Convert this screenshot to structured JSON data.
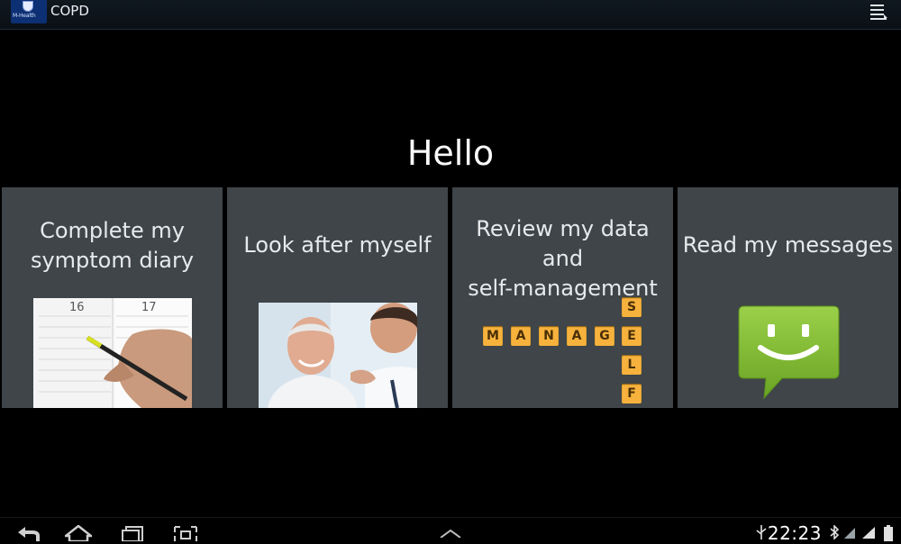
{
  "action_bar": {
    "title": "COPD",
    "logo_text": "M-Health",
    "menu_icon": "overflow-menu-icon"
  },
  "greeting": "Hello",
  "tiles": [
    {
      "label_line1": "Complete my",
      "label_line2": "symptom diary",
      "image": "diary-writing-photo"
    },
    {
      "label": "Look after myself",
      "image": "doctor-patient-photo"
    },
    {
      "label_line1": "Review my data and",
      "label_line2": "self-management",
      "image": "manage-self-letter-tiles",
      "letters_across": [
        "M",
        "A",
        "N",
        "A",
        "G",
        "E"
      ],
      "letters_down": [
        "S",
        "E",
        "L",
        "F"
      ]
    },
    {
      "label": "Read my messages",
      "image": "smiley-message-icon"
    }
  ],
  "navigation": {
    "back": "back-icon",
    "home": "home-icon",
    "recent": "recent-apps-icon",
    "screenshot": "screenshot-icon",
    "up": "chevron-up-icon"
  },
  "status": {
    "time": "22:23",
    "icons": [
      "usb-icon",
      "bluetooth-icon",
      "wifi-icon",
      "signal-icon",
      "battery-icon"
    ]
  },
  "colors": {
    "tile_bg": "#3f4548",
    "letter_tile": "#f6b23c",
    "message_green": "#7fbb2e"
  }
}
